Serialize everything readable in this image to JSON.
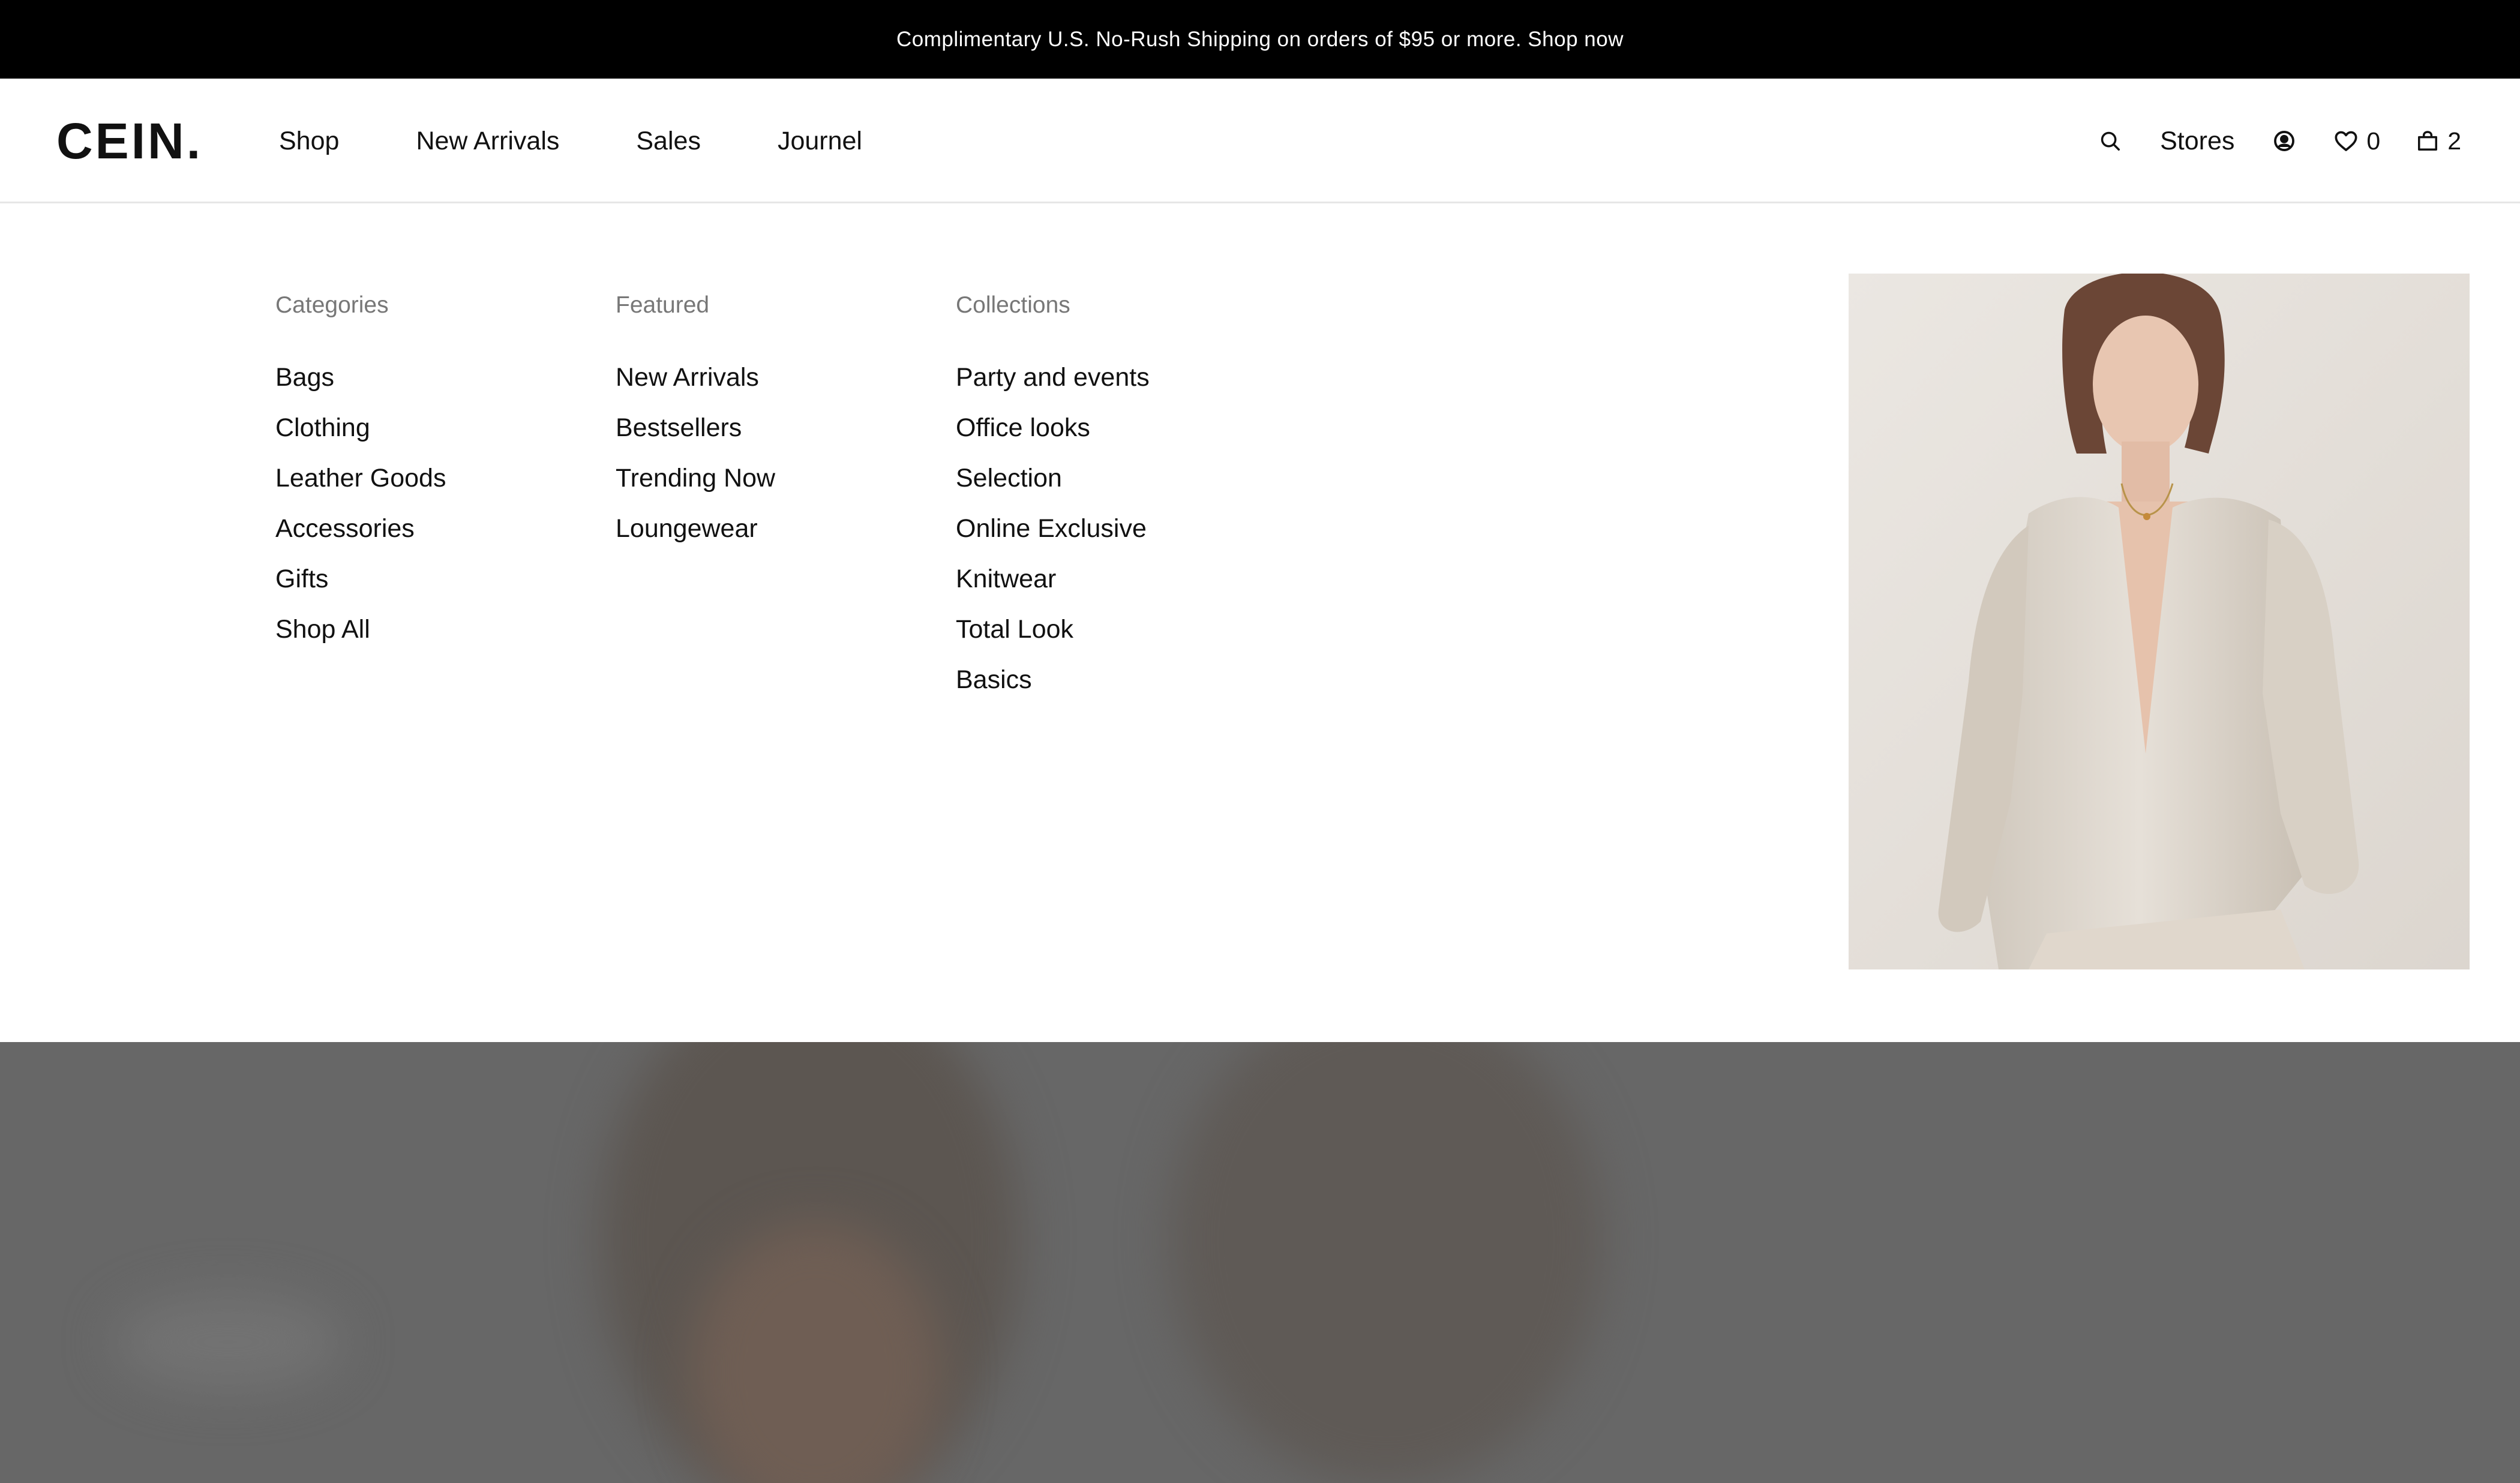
{
  "announcement": {
    "text": "Complimentary U.S. No-Rush Shipping on orders of $95 or more. Shop now"
  },
  "header": {
    "logo": "CEIN.",
    "nav": [
      "Shop",
      "New Arrivals",
      "Sales",
      "Journel"
    ],
    "utility": {
      "search_icon": "search-icon",
      "stores_label": "Stores",
      "account_icon": "account-icon",
      "wishlist_icon": "heart-icon",
      "wishlist_count": "0",
      "bag_icon": "shopping-bag-icon",
      "bag_count": "2"
    }
  },
  "mega_menu": {
    "categories": {
      "heading": "Categories",
      "items": [
        "Bags",
        "Clothing",
        "Leather Goods",
        "Accessories",
        "Gifts",
        "Shop All"
      ]
    },
    "featured": {
      "heading": "Featured",
      "items": [
        "New Arrivals",
        "Bestsellers",
        "Trending Now",
        "Loungewear"
      ]
    },
    "collections": {
      "heading": "Collections",
      "items": [
        "Party and events",
        "Office looks",
        "Selection",
        "Online Exclusive",
        "Knitwear",
        "Total Look",
        "Basics"
      ]
    }
  },
  "colors": {
    "announcement_bg": "#000000",
    "text": "#111111",
    "muted": "#777777",
    "overlay": "#676767"
  }
}
